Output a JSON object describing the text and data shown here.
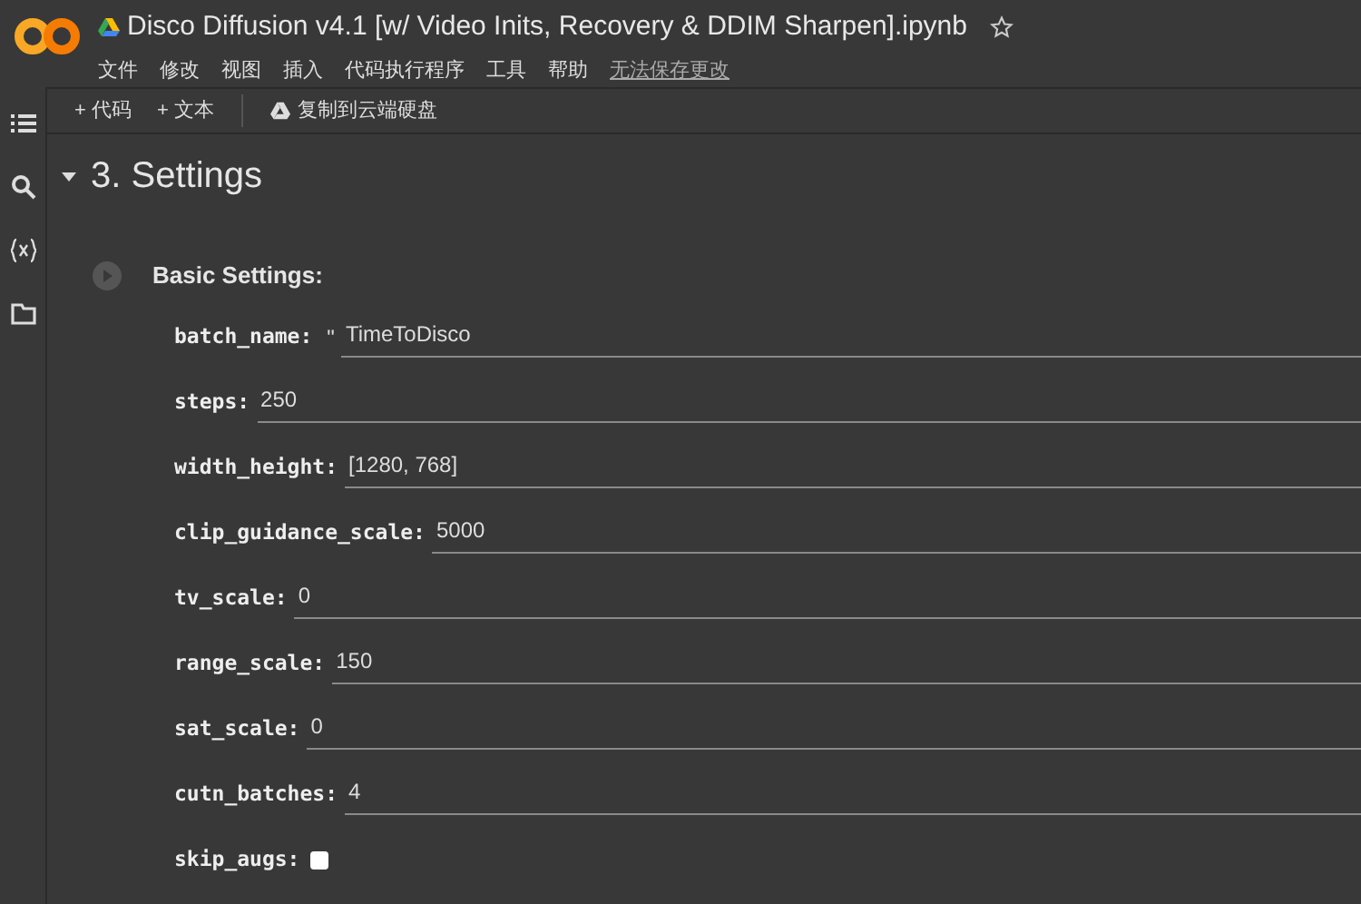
{
  "notebook": {
    "title": "Disco Diffusion v4.1 [w/ Video Inits, Recovery & DDIM Sharpen].ipynb",
    "menu": [
      "文件",
      "修改",
      "视图",
      "插入",
      "代码执行程序",
      "工具",
      "帮助"
    ],
    "save_notice": "无法保存更改"
  },
  "toolbar": {
    "add_buttons": [
      "+ 代码",
      "+ 文本"
    ],
    "copy_button": "复制到云端硬盘"
  },
  "section": {
    "title": "3. Settings",
    "expanded": true
  },
  "form": {
    "title": "Basic Settings:",
    "fields": [
      {
        "kind": "text",
        "label": "batch_name:",
        "prefix": "\"",
        "value": "TimeToDisco"
      },
      {
        "kind": "text",
        "label": "steps:",
        "value": "250"
      },
      {
        "kind": "text",
        "label": "width_height:",
        "value": "[1280, 768]"
      },
      {
        "kind": "text",
        "label": "clip_guidance_scale:",
        "value": "5000"
      },
      {
        "kind": "text",
        "label": "tv_scale:",
        "value": "0"
      },
      {
        "kind": "text",
        "label": "range_scale:",
        "value": "150"
      },
      {
        "kind": "text",
        "label": "sat_scale:",
        "value": "0"
      },
      {
        "kind": "text",
        "label": "cutn_batches:",
        "value": "4"
      },
      {
        "kind": "checkbox",
        "label": "skip_augs:",
        "checked": false
      }
    ]
  }
}
